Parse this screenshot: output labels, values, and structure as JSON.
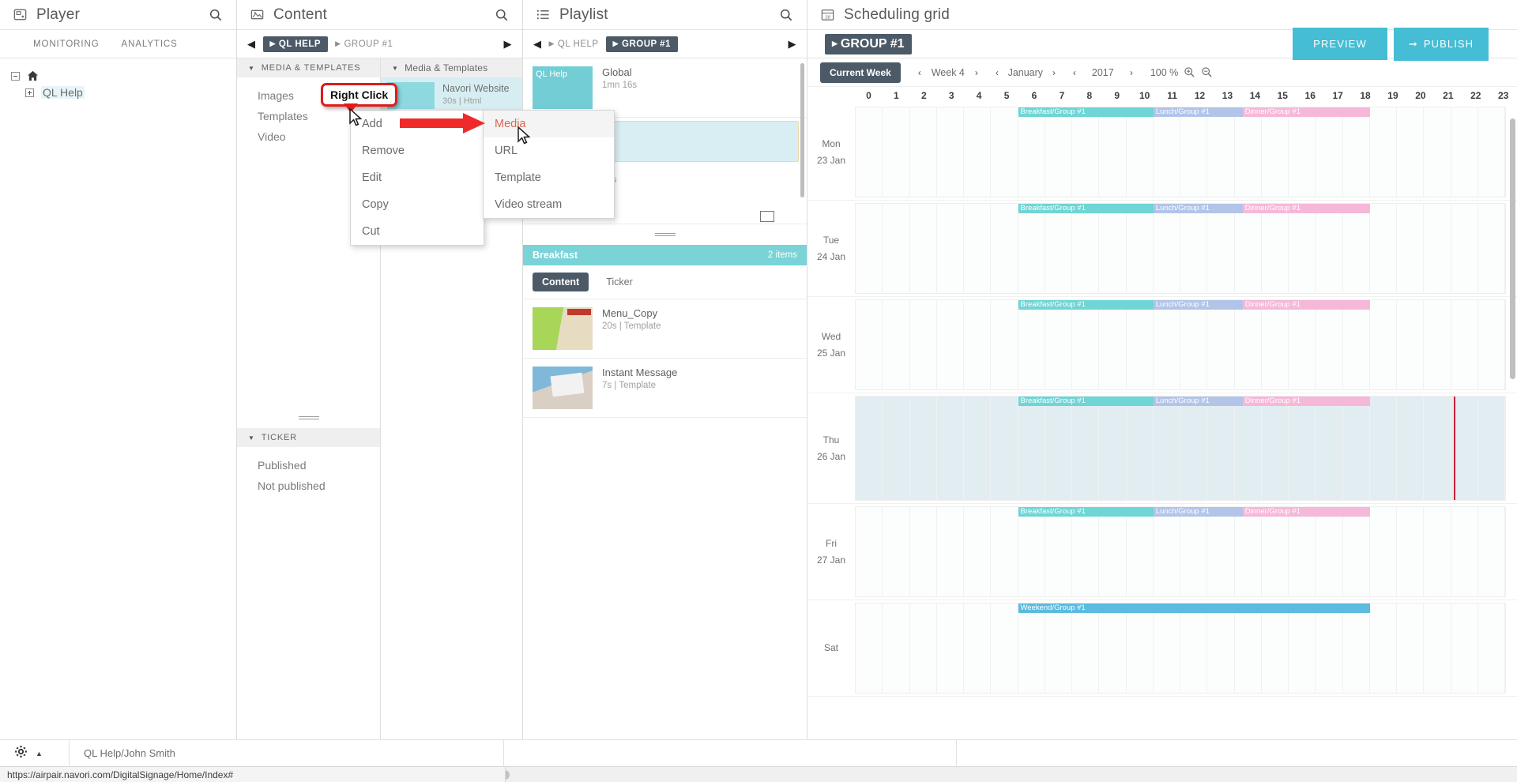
{
  "player": {
    "title": "Player",
    "search_icon": "search-icon",
    "subnav": [
      {
        "label": "MONITORING"
      },
      {
        "label": "ANALYTICS"
      }
    ],
    "tree": [
      {
        "label": "",
        "icon": "home-icon"
      },
      {
        "label": "QL Help",
        "icon": "expand-plus-icon"
      }
    ]
  },
  "content": {
    "title": "Content",
    "search_icon": "search-icon",
    "breadcrumb": {
      "prev_icon": "prev-arrow-icon",
      "next_icon": "next-arrow-icon",
      "items": [
        {
          "label": "QL HELP",
          "active": true
        },
        {
          "label": "GROUP #1",
          "active": false
        }
      ]
    },
    "left_sections": [
      {
        "header": "MEDIA & TEMPLATES",
        "items": [
          "Images",
          "Templates",
          "Video"
        ]
      },
      {
        "header": "TICKER",
        "items": [
          "Published",
          "Not published"
        ]
      }
    ],
    "right_section": {
      "header": "Media & Templates",
      "items": [
        {
          "name": "Navori Website",
          "meta_duration": "30s",
          "meta_sep": "|",
          "meta_type": "Html",
          "thumb_color": "#8ed8e0"
        }
      ]
    }
  },
  "playlist": {
    "title": "Playlist",
    "search_icon": "search-icon",
    "breadcrumb": {
      "prev_icon": "prev-arrow-icon",
      "next_icon": "next-arrow-icon",
      "items": [
        {
          "label": "QL HELP",
          "active": false
        },
        {
          "label": "GROUP #1",
          "active": true
        }
      ]
    },
    "items": [
      {
        "thumb_label": "QL Help",
        "name": "Global",
        "meta": "1mn 16s",
        "thumb_color": "#72cdd4"
      },
      {
        "thumb_label": "",
        "name": "",
        "meta": "14s",
        "thumb_color": "#c0cfe4"
      }
    ],
    "group": {
      "name": "Breakfast",
      "count_label": "2 items",
      "tabs": [
        {
          "label": "Content",
          "active": true
        },
        {
          "label": "Ticker",
          "active": false
        }
      ],
      "media": [
        {
          "name": "Menu_Copy",
          "duration": "20s",
          "sep": "|",
          "type": "Template"
        },
        {
          "name": "Instant Message",
          "duration": "7s",
          "sep": "|",
          "type": "Template"
        }
      ]
    }
  },
  "scheduling": {
    "title": "Scheduling grid",
    "calendar_icon": "calendar-28-icon",
    "breadcrumb": {
      "label": "GROUP #1"
    },
    "preview_button": "PREVIEW",
    "publish_button": "PUBLISH",
    "publish_icon": "arrow-right-icon",
    "toolbar": {
      "current_week": "Current Week",
      "week": "Week 4",
      "month": "January",
      "year": "2017",
      "zoom_level": "100 %",
      "zoom_in_icon": "zoom-in-icon",
      "zoom_out_icon": "zoom-out-icon",
      "prev_icon": "chevron-left-icon",
      "next_icon": "chevron-right-icon"
    },
    "hours": [
      "0",
      "1",
      "2",
      "3",
      "4",
      "5",
      "6",
      "7",
      "8",
      "9",
      "10",
      "11",
      "12",
      "13",
      "14",
      "15",
      "16",
      "17",
      "18",
      "19",
      "20",
      "21",
      "22",
      "23"
    ],
    "colors": {
      "breakfast": "#6fd5d5",
      "lunch": "#b2c4e8",
      "dinner": "#f6b8d8",
      "weekend": "#5bbbe0",
      "now_marker": "#c7233c",
      "selected_day": "#e2edf2",
      "accent_teal": "#45bdd4",
      "dark_pill": "#4c5a68"
    },
    "days": [
      {
        "dow": "Mon",
        "date": "23 Jan",
        "selected": false,
        "show_now": false,
        "events": [
          {
            "label": "Breakfast/Group #1",
            "start": 6,
            "end": 11,
            "kind": "breakfast"
          },
          {
            "label": "Lunch/Group #1",
            "start": 11,
            "end": 14.3,
            "kind": "lunch"
          },
          {
            "label": "Dinner/Group #1",
            "start": 14.3,
            "end": 19,
            "kind": "dinner"
          }
        ]
      },
      {
        "dow": "Tue",
        "date": "24 Jan",
        "selected": false,
        "show_now": false,
        "events": [
          {
            "label": "Breakfast/Group #1",
            "start": 6,
            "end": 11,
            "kind": "breakfast"
          },
          {
            "label": "Lunch/Group #1",
            "start": 11,
            "end": 14.3,
            "kind": "lunch"
          },
          {
            "label": "Dinner/Group #1",
            "start": 14.3,
            "end": 19,
            "kind": "dinner"
          }
        ]
      },
      {
        "dow": "Wed",
        "date": "25 Jan",
        "selected": false,
        "show_now": false,
        "events": [
          {
            "label": "Breakfast/Group #1",
            "start": 6,
            "end": 11,
            "kind": "breakfast"
          },
          {
            "label": "Lunch/Group #1",
            "start": 11,
            "end": 14.3,
            "kind": "lunch"
          },
          {
            "label": "Dinner/Group #1",
            "start": 14.3,
            "end": 19,
            "kind": "dinner"
          }
        ]
      },
      {
        "dow": "Thu",
        "date": "26 Jan",
        "selected": true,
        "show_now": true,
        "now_hour": 22.1,
        "events": [
          {
            "label": "Breakfast/Group #1",
            "start": 6,
            "end": 11,
            "kind": "breakfast"
          },
          {
            "label": "Lunch/Group #1",
            "start": 11,
            "end": 14.3,
            "kind": "lunch"
          },
          {
            "label": "Dinner/Group #1",
            "start": 14.3,
            "end": 19,
            "kind": "dinner"
          }
        ]
      },
      {
        "dow": "Fri",
        "date": "27 Jan",
        "selected": false,
        "show_now": false,
        "events": [
          {
            "label": "Breakfast/Group #1",
            "start": 6,
            "end": 11,
            "kind": "breakfast"
          },
          {
            "label": "Lunch/Group #1",
            "start": 11,
            "end": 14.3,
            "kind": "lunch"
          },
          {
            "label": "Dinner/Group #1",
            "start": 14.3,
            "end": 19,
            "kind": "dinner"
          }
        ]
      },
      {
        "dow": "Sat",
        "date": "",
        "selected": false,
        "show_now": false,
        "events": [
          {
            "label": "Weekend/Group #1",
            "start": 6,
            "end": 19,
            "kind": "weekend"
          }
        ]
      }
    ]
  },
  "context_menu_main": {
    "items": [
      {
        "label": "Add",
        "highlighted": false
      },
      {
        "label": "Remove",
        "highlighted": false
      },
      {
        "label": "Edit",
        "highlighted": false
      },
      {
        "label": "Copy",
        "highlighted": false
      },
      {
        "label": "Cut",
        "highlighted": false
      }
    ]
  },
  "context_menu_sub": {
    "items": [
      {
        "label": "Media",
        "highlighted": true
      },
      {
        "label": "URL",
        "highlighted": false
      },
      {
        "label": "Template",
        "highlighted": false
      },
      {
        "label": "Video stream",
        "highlighted": false
      }
    ]
  },
  "annotations": {
    "callout_label": "Right Click",
    "callout_border_color": "#e01b1b",
    "arrow_color": "#ef2a2a"
  },
  "statusbar": {
    "gear_icon": "gear-icon",
    "caret_icon": "caret-up-icon",
    "user": "QL Help/John Smith"
  },
  "urlbar": {
    "url": "https://airpair.navori.com/DigitalSignage/Home/Index#"
  }
}
